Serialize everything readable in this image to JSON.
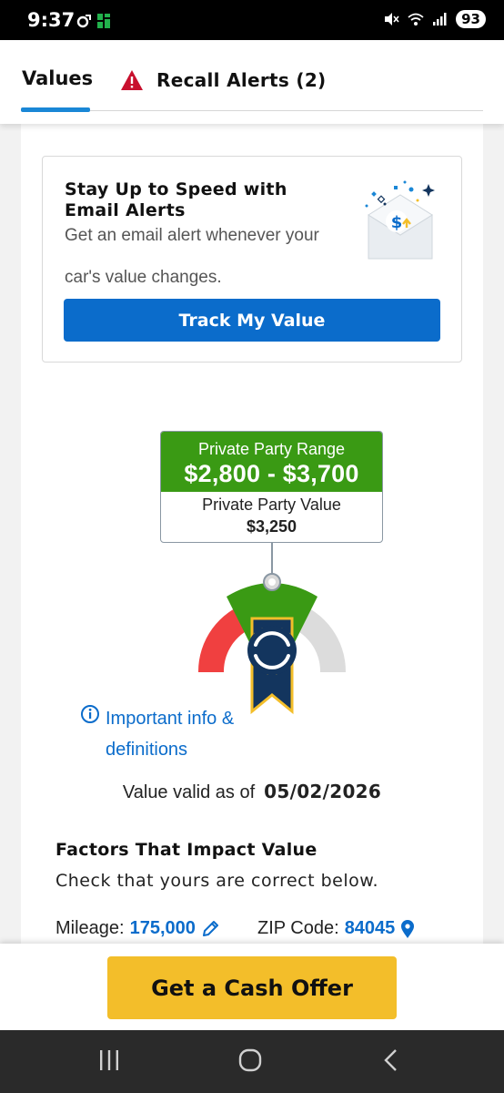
{
  "status_bar": {
    "time": "9:37",
    "battery": "93"
  },
  "tabs": {
    "values_label": "Values",
    "recall_label": "Recall Alerts (2)"
  },
  "email_alert": {
    "title": "Stay Up to Speed with Email Alerts",
    "description": "Get an email alert whenever your car's value changes.",
    "button_label": "Track My Value"
  },
  "value_box": {
    "range_label": "Private Party Range",
    "range_value": "$2,800 - $3,700",
    "ppv_label": "Private Party Value",
    "ppv_value": "$3,250"
  },
  "info": {
    "link_text": "Important info & definitions",
    "valid_label": "Value valid as of",
    "valid_date": "05/02/2026"
  },
  "factors": {
    "title": "Factors That Impact Value",
    "description": "Check that yours are correct below.",
    "mileage_label": "Mileage:",
    "mileage_value": "175,000",
    "zip_label": "ZIP Code:",
    "zip_value": "84045"
  },
  "cta": {
    "label": "Get a Cash Offer"
  },
  "colors": {
    "brand_blue": "#0b6ccb",
    "range_green": "#3a9a14",
    "cta_yellow": "#f3be2a",
    "gauge_red": "#f04040",
    "alert_red": "#c8102e"
  }
}
